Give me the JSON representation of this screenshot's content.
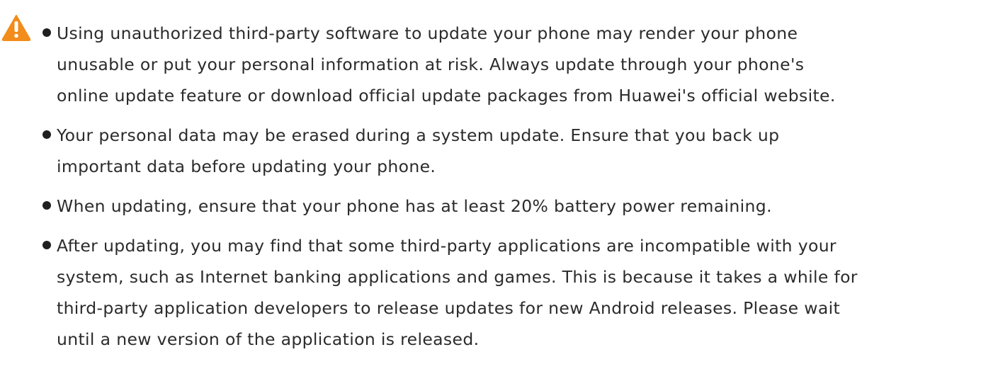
{
  "warning": {
    "icon": "warning-triangle-icon",
    "color": "#f28c1a"
  },
  "notices": [
    {
      "lines": [
        "Using unauthorized third-party software to update your phone may render your phone",
        "unusable or put your personal information at risk. Always update through your phone's",
        "online update feature or download official update packages from Huawei's official website."
      ]
    },
    {
      "lines": [
        "Your personal data may be erased during a system update. Ensure that you back up",
        "important data before updating your phone."
      ]
    },
    {
      "lines": [
        "When updating, ensure that your phone has at least 20% battery power remaining."
      ]
    },
    {
      "lines": [
        "After updating, you may find that some third-party applications are incompatible with your",
        "system, such as Internet banking applications and games. This is because it takes a while for",
        "third-party application developers to release updates for new Android releases. Please wait",
        "until a new version of the application is released."
      ]
    }
  ]
}
